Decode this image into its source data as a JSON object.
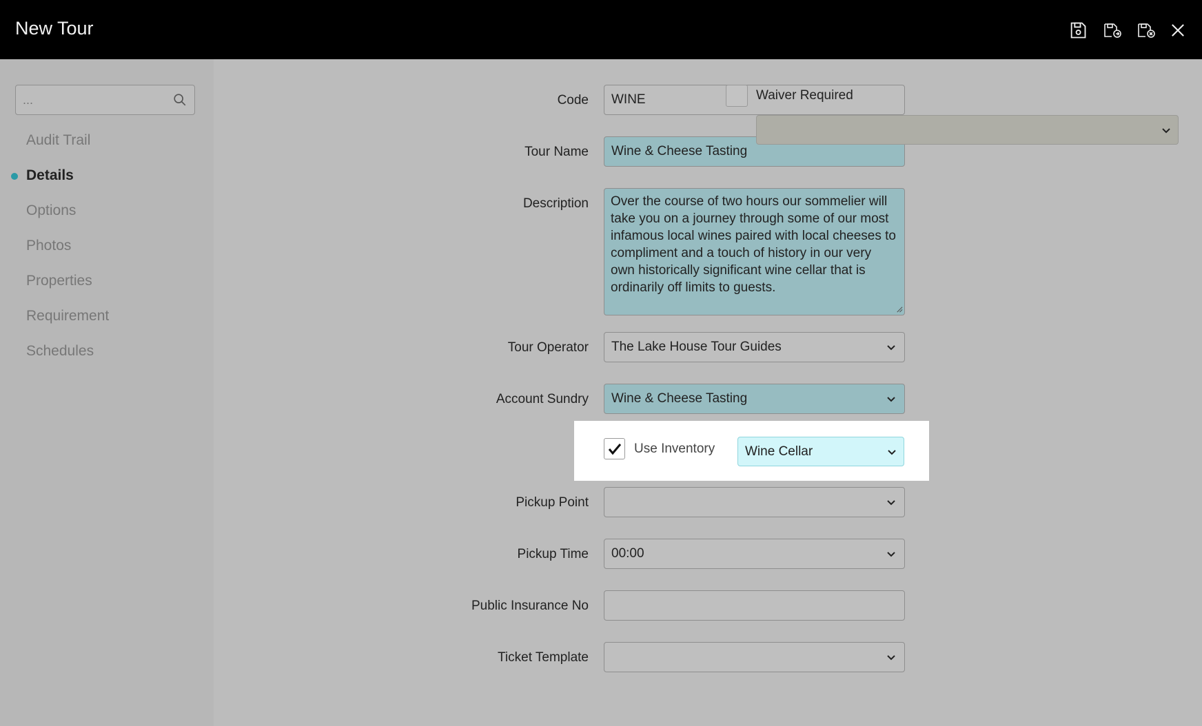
{
  "window": {
    "title": "New Tour"
  },
  "toolbar": {
    "save_icon": "floppy-disk-icon",
    "save_and_new_icon": "floppy-disk-plus-icon",
    "save_and_close_icon": "floppy-disk-x-icon",
    "close_icon": "close-icon"
  },
  "sidebar": {
    "search_placeholder": "...",
    "items": [
      {
        "label": "Audit Trail",
        "active": false
      },
      {
        "label": "Details",
        "active": true
      },
      {
        "label": "Options",
        "active": false
      },
      {
        "label": "Photos",
        "active": false
      },
      {
        "label": "Properties",
        "active": false
      },
      {
        "label": "Requirement",
        "active": false
      },
      {
        "label": "Schedules",
        "active": false
      }
    ]
  },
  "form": {
    "code": {
      "label": "Code",
      "value": "WINE"
    },
    "tour_name": {
      "label": "Tour Name",
      "value": "Wine & Cheese Tasting"
    },
    "description": {
      "label": "Description",
      "value": "Over the course of two hours our sommelier will take you on a journey through some of our most infamous local wines paired with local cheeses to compliment and a touch of history in our very own historically significant wine cellar that is ordinarily off limits to guests."
    },
    "tour_operator": {
      "label": "Tour Operator",
      "value": "The Lake House Tour Guides"
    },
    "account_sundry": {
      "label": "Account Sundry",
      "value": "Wine & Cheese Tasting"
    },
    "use_inventory": {
      "label": "Use Inventory",
      "checked": true,
      "value": "Wine Cellar"
    },
    "pickup_point": {
      "label": "Pickup Point",
      "value": ""
    },
    "pickup_time": {
      "label": "Pickup Time",
      "value": "00:00"
    },
    "public_insurance_no": {
      "label": "Public Insurance No",
      "value": ""
    },
    "ticket_template": {
      "label": "Ticket Template",
      "value": ""
    },
    "waiver_required": {
      "label": "Waiver Required",
      "checked": false,
      "value": ""
    }
  },
  "colors": {
    "title_bar": "#000000",
    "accent": "#2a9aa6",
    "required_field": "#97bcc1",
    "highlight_select": "#d2f6fa"
  }
}
